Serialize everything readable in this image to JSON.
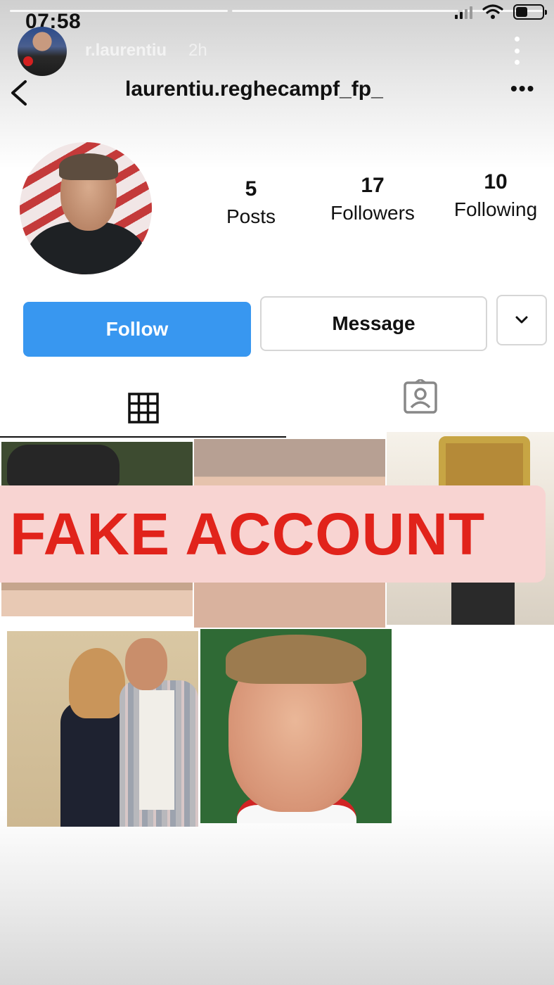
{
  "status_bar": {
    "time": "07:58",
    "icons": [
      "cellular-signal-icon",
      "wifi-icon",
      "battery-icon"
    ]
  },
  "story": {
    "username": "r.laurentiu",
    "time_ago": "2h",
    "progress_segments": 3
  },
  "profile": {
    "username": "laurentiu.reghecampf_fp_",
    "stats": [
      {
        "value": "5",
        "label": "Posts"
      },
      {
        "value": "17",
        "label": "Followers"
      },
      {
        "value": "10",
        "label": "Following"
      }
    ]
  },
  "actions": {
    "follow_label": "Follow",
    "message_label": "Message"
  },
  "tabs": [
    {
      "icon": "grid-icon",
      "active": true
    },
    {
      "icon": "tagged-icon",
      "active": false
    }
  ],
  "overlay": {
    "text": "FAKE ACCOUNT"
  },
  "colors": {
    "follow_button": "#3897f0",
    "overlay_background": "#f8d4d2",
    "overlay_text": "#e1231b"
  }
}
